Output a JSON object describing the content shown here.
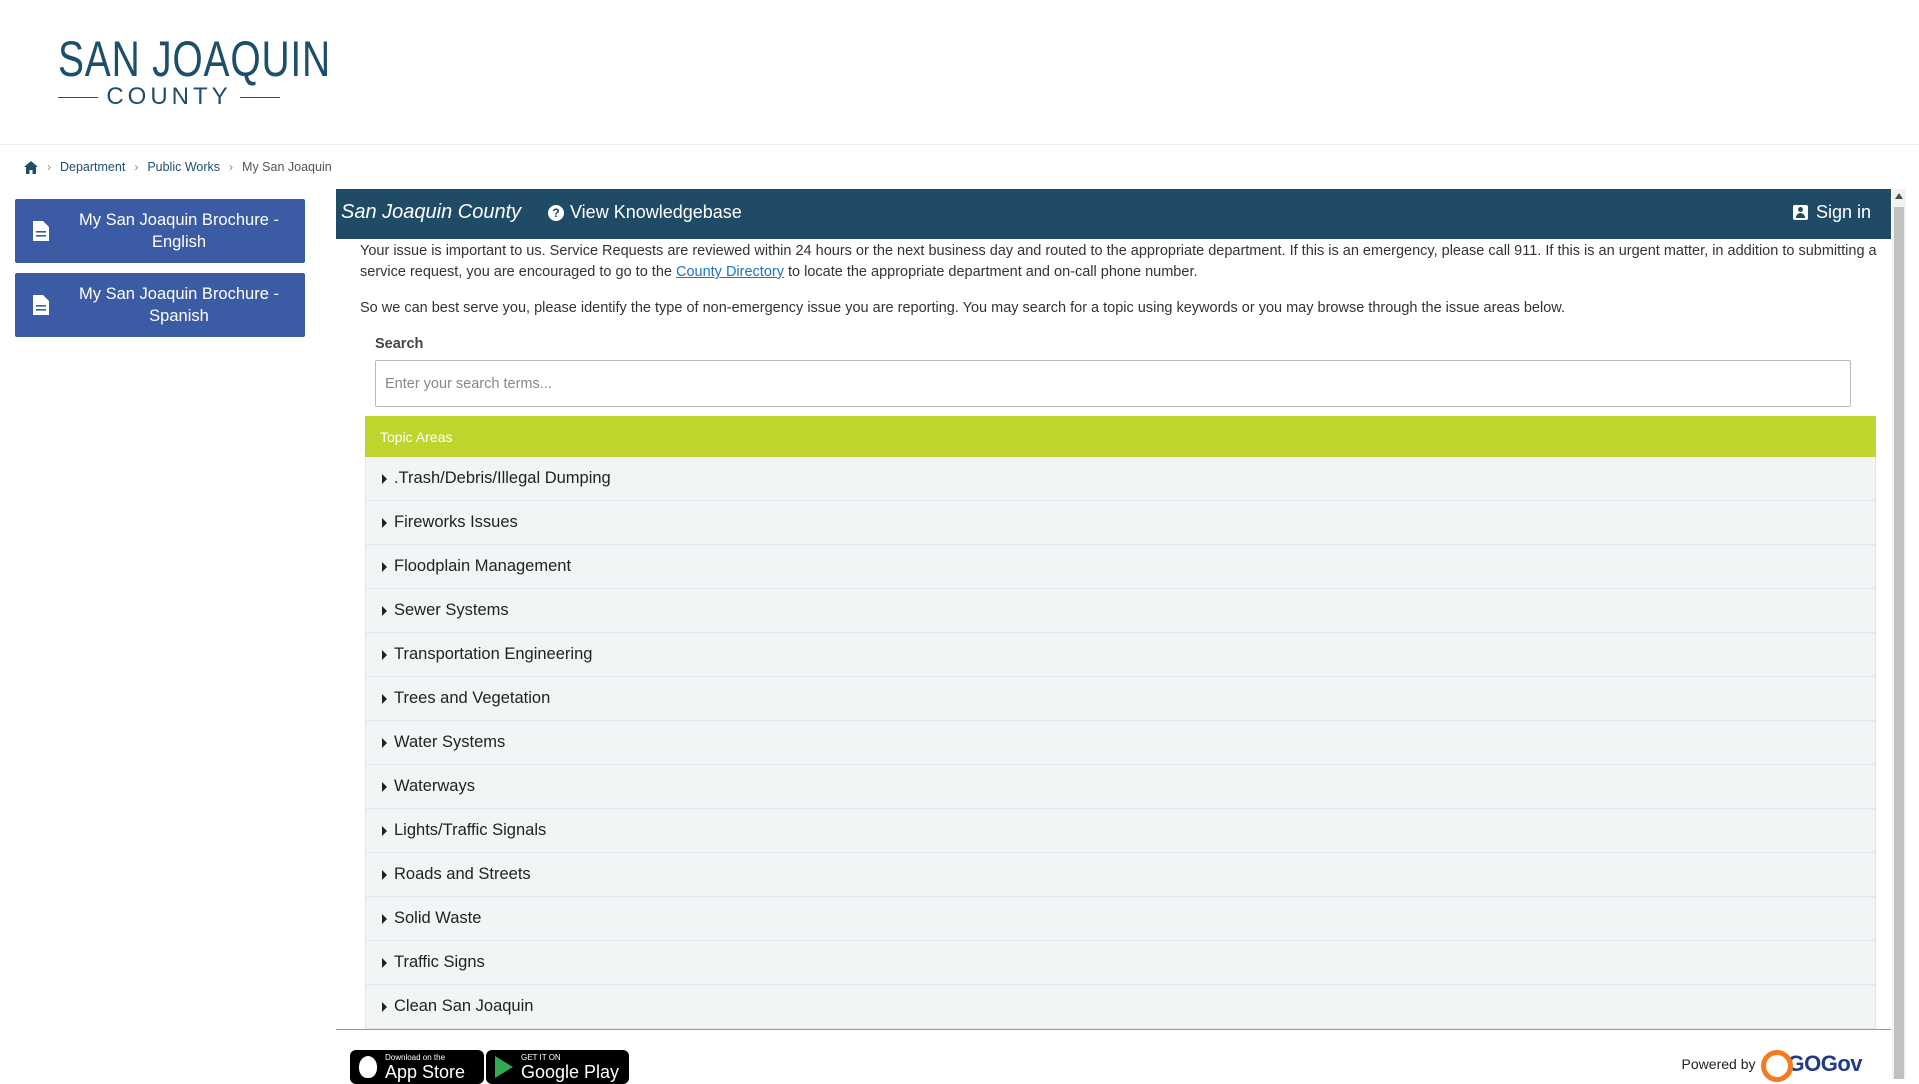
{
  "header": {
    "logo_top": "SAN JOAQUIN",
    "logo_bottom": "COUNTY"
  },
  "breadcrumb": {
    "items": [
      "Department",
      "Public Works"
    ],
    "current": "My San Joaquin"
  },
  "sidebar": {
    "buttons": [
      {
        "label": "My San Joaquin Brochure - English"
      },
      {
        "label": "My San Joaquin Brochure - Spanish"
      }
    ]
  },
  "topbar": {
    "brand": "San Joaquin County",
    "knowledgebase": "View Knowledgebase",
    "signin": "Sign in"
  },
  "intro": {
    "text_before_link": "Your issue is important to us. Service Requests are reviewed within 24 hours or the next business day and routed to the appropriate department. If this is an emergency, please call 911. If this is an urgent matter, in addition to submitting a service request, you are encouraged to go to the ",
    "link": "County Directory",
    "text_after_link": " to locate the appropriate department and on-call phone number.",
    "second": "So we can best serve you, please identify the type of non-emergency issue you are reporting. You may search for a topic using keywords or you may browse through the issue areas below."
  },
  "search": {
    "label": "Search",
    "placeholder": "Enter your search terms...",
    "value": ""
  },
  "topics": {
    "heading": "Topic Areas",
    "items": [
      ".Trash/Debris/Illegal Dumping",
      "Fireworks Issues",
      "Floodplain Management",
      "Sewer Systems",
      "Transportation Engineering",
      "Trees and Vegetation",
      "Water Systems",
      "Waterways",
      "Lights/Traffic Signals",
      "Roads and Streets",
      "Solid Waste",
      "Traffic Signs",
      "Clean San Joaquin"
    ]
  },
  "footer": {
    "appstore_small": "Download on the",
    "appstore_big": "App Store",
    "googleplay_small": "GET IT ON",
    "googleplay_big": "Google Play",
    "powered_by": "Powered by",
    "gogov": "GOGov"
  },
  "colors": {
    "topbar": "#1f4b67",
    "sidebar_button": "#3b5ba5",
    "topic_header": "#bfd52e",
    "link": "#1a73c4"
  },
  "icons": {
    "home": "home-icon",
    "document": "document-icon",
    "help": "question-circle-icon",
    "user": "user-icon",
    "caret": "caret-right-icon"
  }
}
